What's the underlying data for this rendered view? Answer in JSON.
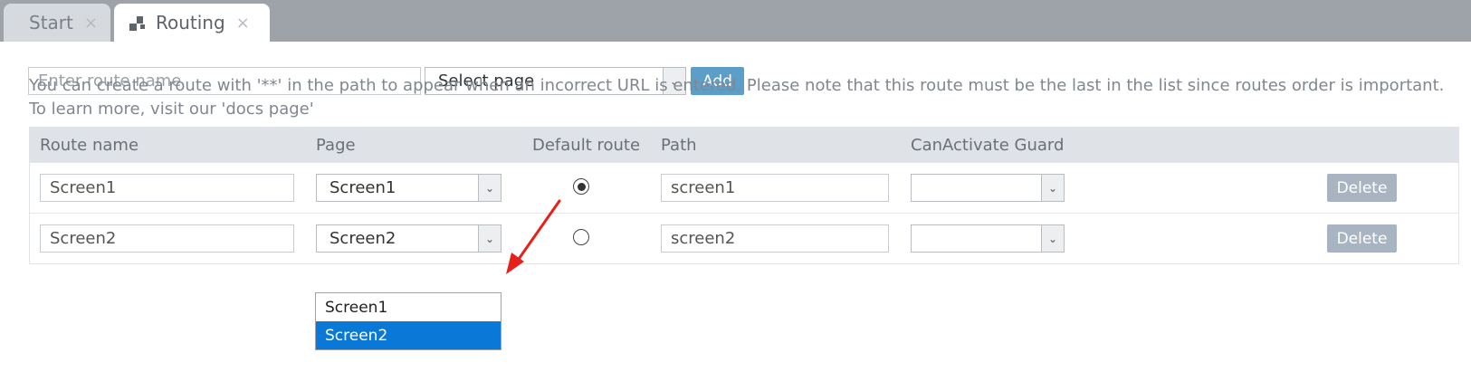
{
  "tabs": [
    {
      "label": "Start",
      "close": "×"
    },
    {
      "label": "Routing",
      "close": "×"
    }
  ],
  "toolbar": {
    "route_name_placeholder": "Enter route name",
    "select_page": "Select page",
    "add_label": "Add"
  },
  "info_text": "You can create a route with '**' in the path to appear when an incorrect URL is entered. Please note that this route must be the last in the list since routes order is important. To learn more, visit our 'docs page'",
  "table": {
    "headers": [
      "Route name",
      "Page",
      "Default route",
      "Path",
      "CanActivate Guard"
    ],
    "rows": [
      {
        "route_name": "Screen1",
        "page": "Screen1",
        "default": true,
        "path": "screen1",
        "guard": "",
        "delete_label": "Delete"
      },
      {
        "route_name": "Screen2",
        "page": "Screen2",
        "default": false,
        "path": "screen2",
        "guard": "",
        "delete_label": "Delete"
      }
    ]
  },
  "page_dropdown": {
    "options": [
      "Screen1",
      "Screen2"
    ],
    "selected": "Screen2"
  },
  "colors": {
    "tabbar": "#9ea3aa",
    "accent_button": "#5b9fc9",
    "delete_button": "#a8b4c1",
    "dropdown_selection": "#0a78d7",
    "annotation_arrow": "#e8201c"
  }
}
